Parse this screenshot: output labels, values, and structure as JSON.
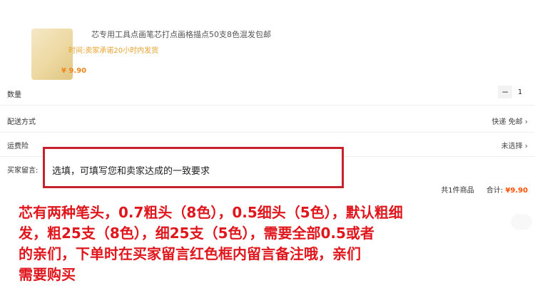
{
  "product": {
    "title": "芯专用工具点画笔芯打点画格描点50支8色混发包邮",
    "shipping_note": "时间:卖家承诺20小时内发货",
    "price": "¥ 9.90"
  },
  "quantity": {
    "label": "数量",
    "minus": "−",
    "value": "1"
  },
  "delivery": {
    "label": "配送方式",
    "value": "快递 免邮"
  },
  "insurance": {
    "label": "运费险",
    "value": "未选择"
  },
  "message": {
    "label": "买家留言:",
    "placeholder": "选填，可填写您和卖家达成的一致要求"
  },
  "summary": {
    "count": "共1件商品",
    "total_label": "合计:",
    "total": "¥9.90"
  },
  "note": {
    "line1": "芯有两种笔头，0.7粗头（8色），0.5细头（5色），默认粗细",
    "line2": "发，粗25支（8色），细25支（5色），需要全部0.5或者",
    "line3": "的亲们，下单时在买家留言红色框内留言备注哦，亲们",
    "line4": "需要购买"
  },
  "icons": {
    "chevron": "›"
  },
  "colors": {
    "accent_red": "#c8232c",
    "price_orange": "#ff5000",
    "note_red": "#e0161d"
  }
}
